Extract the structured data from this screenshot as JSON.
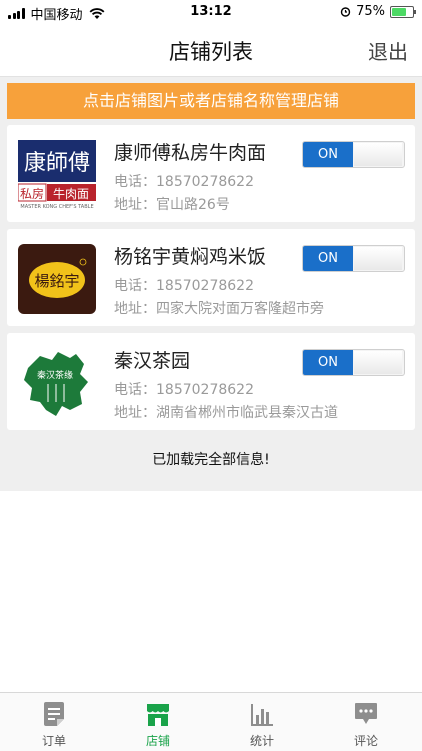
{
  "status_bar": {
    "carrier": "中国移动",
    "time": "13:12",
    "battery": "75%",
    "battery_level": 0.75
  },
  "nav": {
    "title": "店铺列表",
    "logout": "退出"
  },
  "banner": "点击店铺图片或者店铺名称管理店铺",
  "shops": [
    {
      "name": "康师傅私房牛肉面",
      "phone": "电话：18570278622",
      "address": "地址：官山路26号",
      "toggle": "ON",
      "logo": {
        "top": "康師傅",
        "bottom_left": "私房",
        "bottom_right": "牛肉面",
        "caption": "MASTER KONG CHEF'S TABLE"
      }
    },
    {
      "name": "杨铭宇黄焖鸡米饭",
      "phone": "电话：18570278622",
      "address": "地址：四家大院对面万客隆超市旁",
      "toggle": "ON",
      "logo": {
        "text": "楊銘宇"
      }
    },
    {
      "name": "秦汉茶园",
      "phone": "电话：18570278622",
      "address": "地址：湖南省郴州市临武县秦汉古道",
      "toggle": "ON",
      "logo": {
        "text": "秦汉茶缘"
      }
    }
  ],
  "loaded_message": "已加载完全部信息!",
  "tabs": [
    {
      "label": "订单",
      "icon": "orders-icon"
    },
    {
      "label": "店铺",
      "icon": "shop-icon",
      "active": true
    },
    {
      "label": "统计",
      "icon": "stats-icon"
    },
    {
      "label": "评论",
      "icon": "comments-icon"
    }
  ],
  "colors": {
    "accent_orange": "#f7a13b",
    "toggle_blue": "#1a6fc9",
    "active_tab_green": "#1aa34a"
  }
}
